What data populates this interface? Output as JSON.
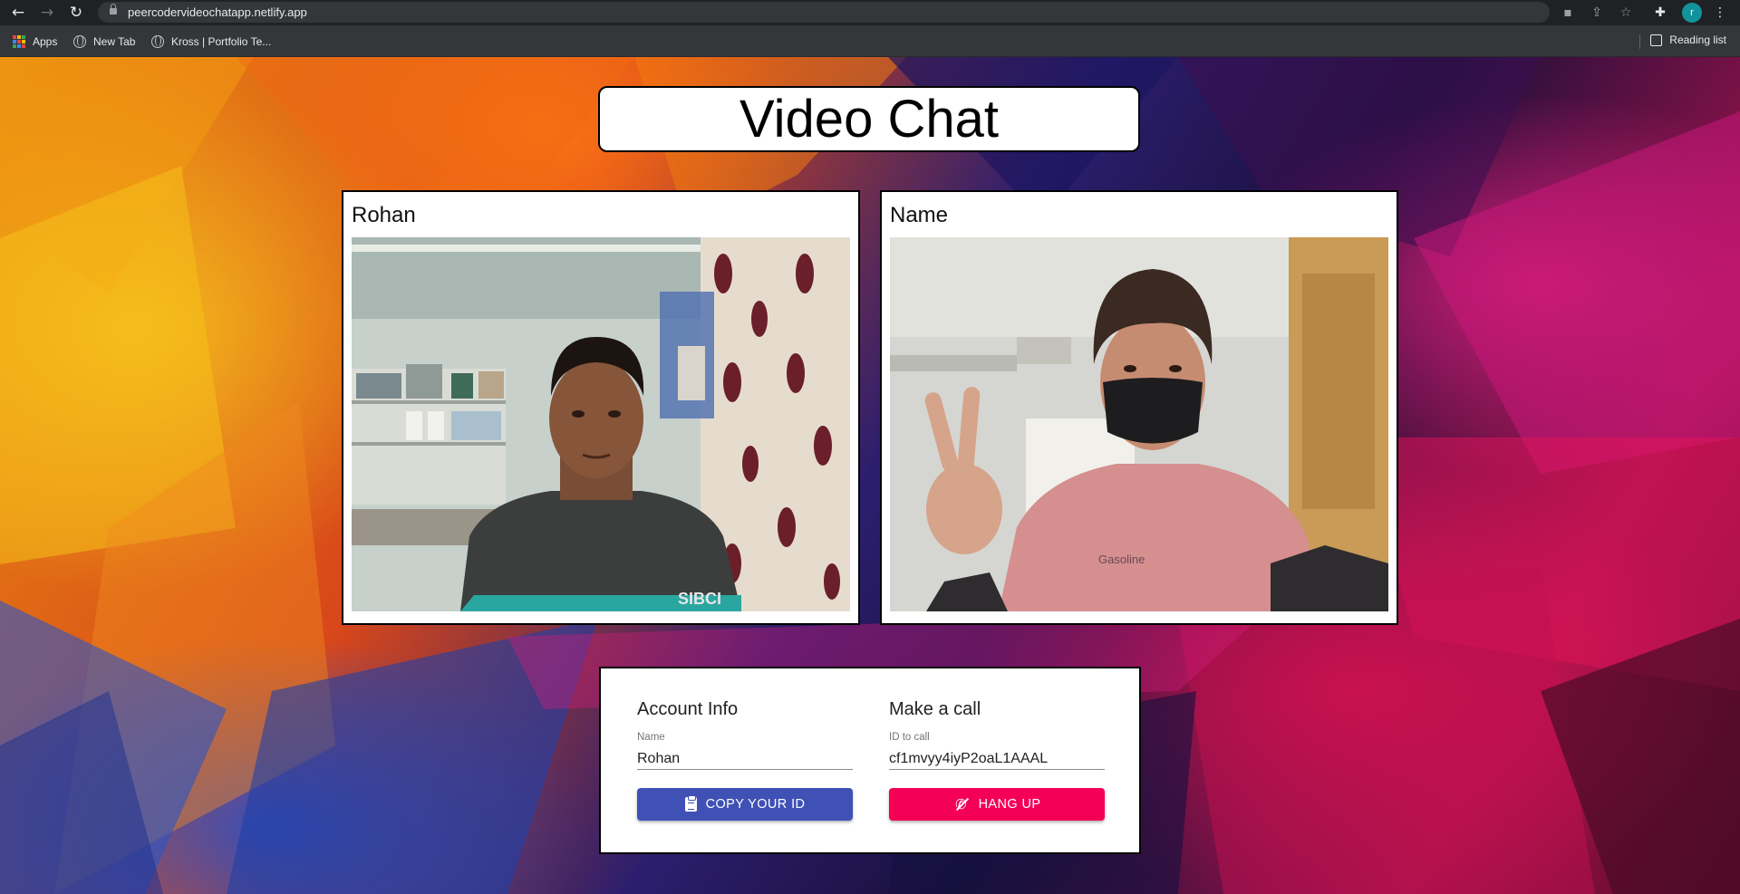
{
  "browser": {
    "url": "peercodervideochatapp.netlify.app",
    "profile_initial": "r",
    "bookmarks": [
      {
        "label": "Apps",
        "icon": "apps-grid-icon"
      },
      {
        "label": "New Tab",
        "icon": "globe-icon"
      },
      {
        "label": "Kross | Portfolio Te...",
        "icon": "globe-icon"
      }
    ],
    "reading_list_label": "Reading list"
  },
  "page": {
    "title": "Video Chat",
    "videos": [
      {
        "name": "Rohan"
      },
      {
        "name": "Name"
      }
    ],
    "account": {
      "heading": "Account Info",
      "name_label": "Name",
      "name_value": "Rohan",
      "copy_button": "COPY YOUR ID"
    },
    "call": {
      "heading": "Make a call",
      "id_label": "ID to call",
      "id_value": "cf1mvyy4iyP2oaL1AAAL",
      "hangup_button": "HANG UP"
    }
  },
  "colors": {
    "primary_button": "#3f51b5",
    "secondary_button": "#f50057"
  }
}
